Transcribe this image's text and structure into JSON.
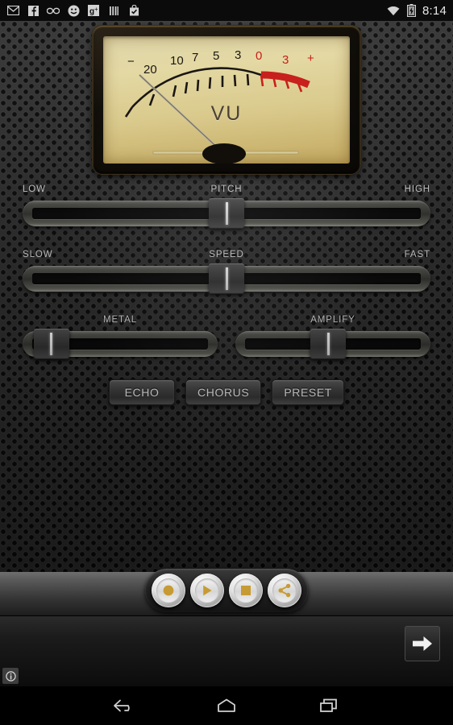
{
  "status_bar": {
    "time": "8:14",
    "left_icons": [
      {
        "name": "gmail-icon",
        "glyph": "M"
      },
      {
        "name": "facebook-icon",
        "glyph": "f"
      },
      {
        "name": "glasses-icon",
        "glyph": "○○"
      },
      {
        "name": "smiley-icon",
        "glyph": "☺"
      },
      {
        "name": "google-plus-icon",
        "glyph": "g+"
      },
      {
        "name": "bars-icon",
        "glyph": "|||"
      },
      {
        "name": "shopping-bag-check-icon",
        "glyph": "✓"
      }
    ],
    "right_icons": [
      {
        "name": "wifi-icon"
      },
      {
        "name": "battery-charging-icon"
      }
    ]
  },
  "vu_meter": {
    "label": "VU",
    "scale_marks": [
      "−",
      "20",
      "10",
      "7",
      "5",
      "3",
      "0",
      "3",
      "+"
    ],
    "red_zone_marks": [
      "0",
      "3",
      "+"
    ],
    "needle_position_percent": 0,
    "red_color": "#c8201c",
    "face_color": "#ded5a9"
  },
  "sliders": [
    {
      "name": "pitch",
      "left_label": "LOW",
      "center_label": "PITCH",
      "right_label": "HIGH",
      "value_percent": 50
    },
    {
      "name": "speed",
      "left_label": "SLOW",
      "center_label": "SPEED",
      "right_label": "FAST",
      "value_percent": 50
    }
  ],
  "small_sliders": [
    {
      "name": "metal",
      "center_label": "METAL",
      "value_percent": 7
    },
    {
      "name": "amplify",
      "center_label": "AMPLIFY",
      "value_percent": 47
    }
  ],
  "fx_buttons": [
    {
      "name": "echo",
      "label": "ECHO"
    },
    {
      "name": "chorus",
      "label": "CHORUS"
    },
    {
      "name": "preset",
      "label": "PRESET"
    }
  ],
  "transport_buttons": [
    {
      "name": "record-button",
      "icon": "record-icon"
    },
    {
      "name": "play-button",
      "icon": "play-icon"
    },
    {
      "name": "stop-button",
      "icon": "stop-icon"
    },
    {
      "name": "share-button",
      "icon": "share-icon"
    }
  ],
  "ad_banner": {
    "arrow_icon": "arrow-right-icon",
    "info_icon": "info-icon"
  },
  "nav_bar": [
    {
      "name": "back-button",
      "icon": "back-arrow-icon"
    },
    {
      "name": "home-button",
      "icon": "home-icon"
    },
    {
      "name": "recents-button",
      "icon": "recents-icon"
    }
  ],
  "theme": {
    "accent_gold": "#c79b33",
    "panel_dark": "#232323",
    "text_light": "#cfcfcf"
  }
}
